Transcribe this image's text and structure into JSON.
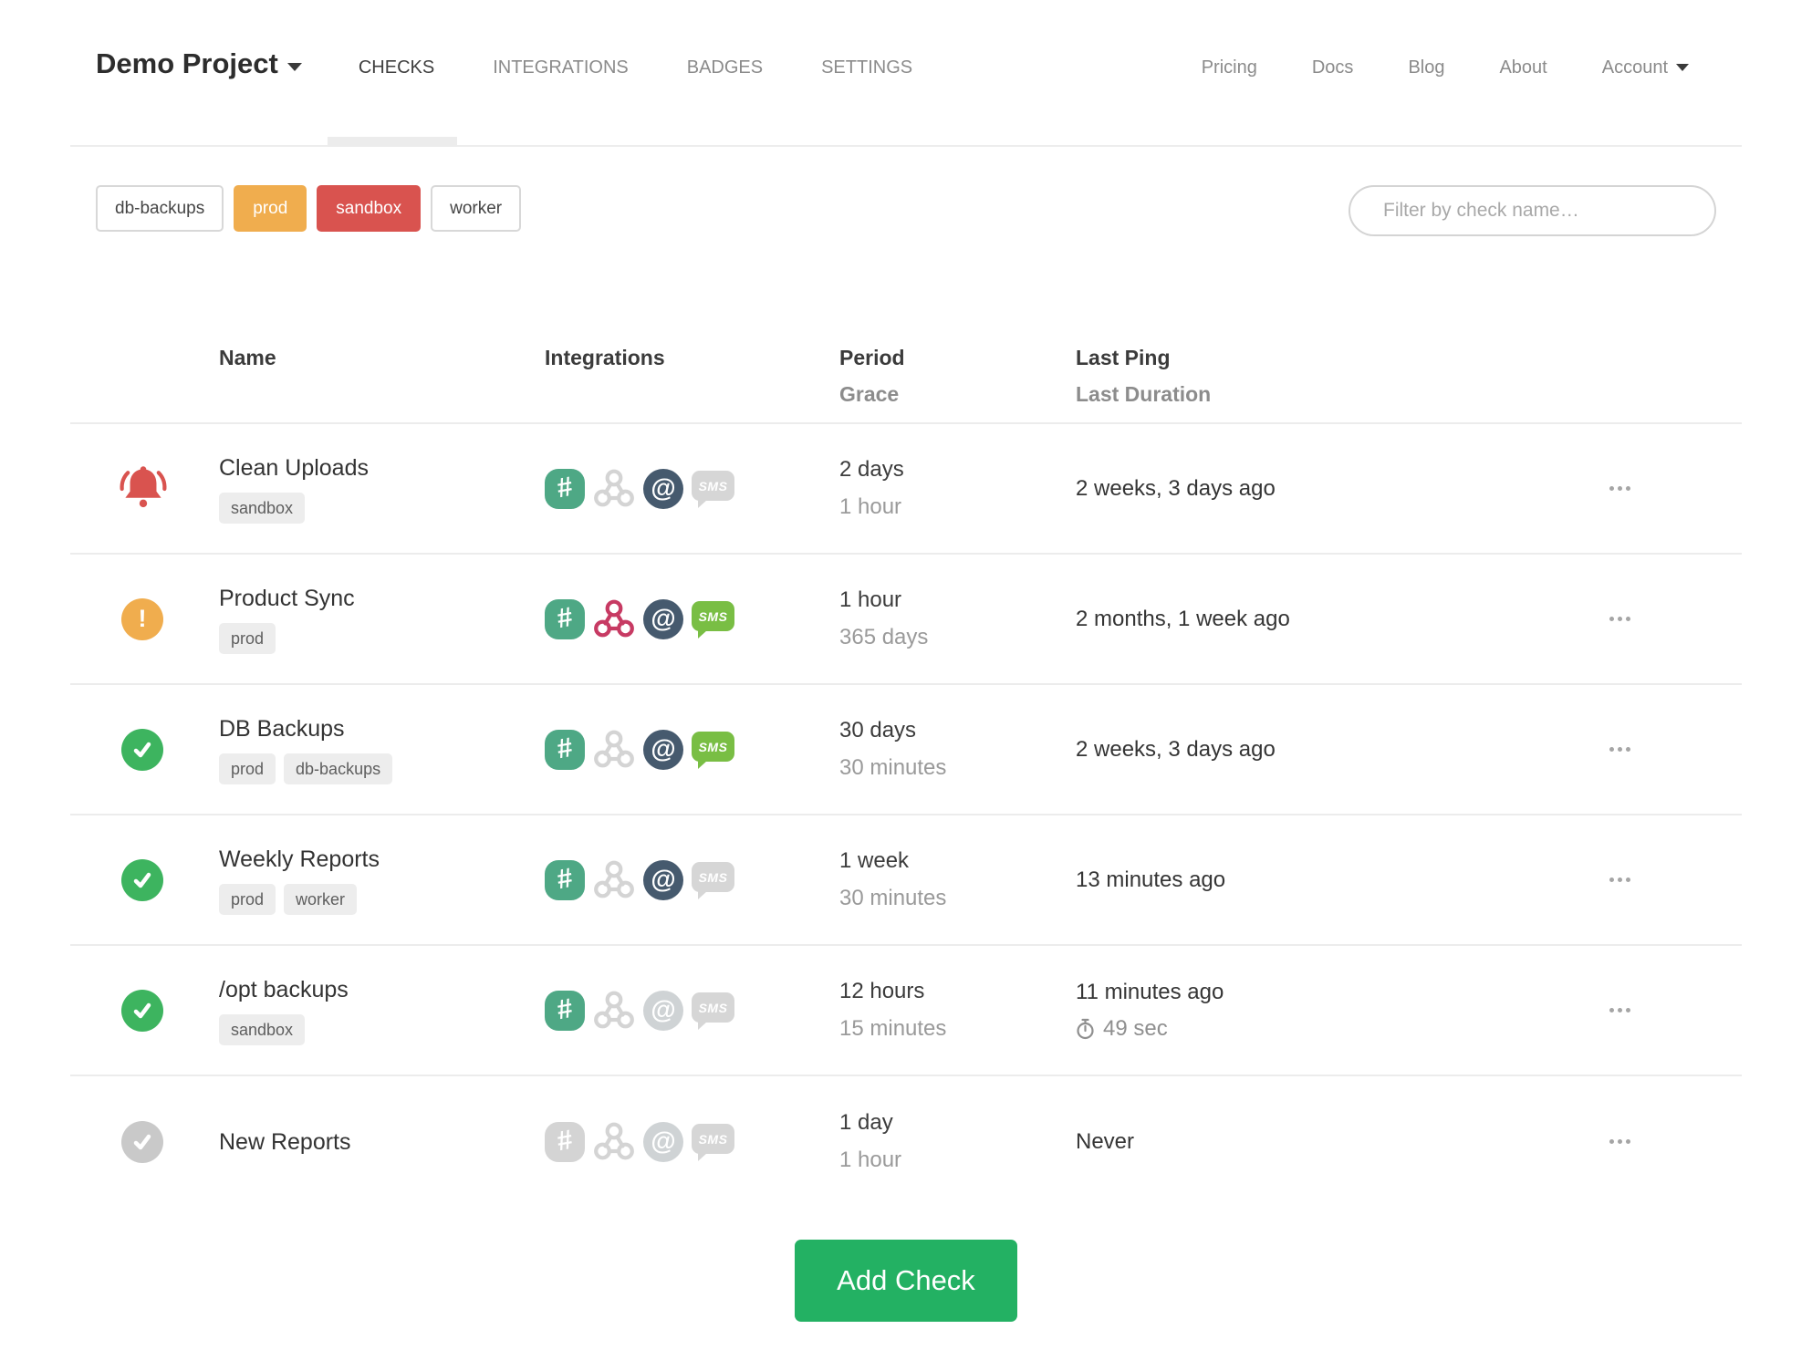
{
  "nav": {
    "project": "Demo Project",
    "tabs": [
      {
        "label": "CHECKS",
        "active": true
      },
      {
        "label": "INTEGRATIONS",
        "active": false
      },
      {
        "label": "BADGES",
        "active": false
      },
      {
        "label": "SETTINGS",
        "active": false
      }
    ],
    "links": [
      "Pricing",
      "Docs",
      "Blog",
      "About"
    ],
    "account_label": "Account"
  },
  "filters": {
    "tags": [
      {
        "label": "db-backups",
        "style": "outline"
      },
      {
        "label": "prod",
        "style": "orange"
      },
      {
        "label": "sandbox",
        "style": "red"
      },
      {
        "label": "worker",
        "style": "outline"
      }
    ],
    "search_placeholder": "Filter by check name…"
  },
  "table": {
    "headers": {
      "name": "Name",
      "integrations": "Integrations",
      "period": "Period",
      "grace": "Grace",
      "last_ping": "Last Ping",
      "last_duration": "Last Duration"
    },
    "rows": [
      {
        "status": "alert",
        "name": "Clean Uploads",
        "tags": [
          "sandbox"
        ],
        "integrations": {
          "slack": true,
          "webhook": false,
          "email": true,
          "sms": false
        },
        "period": "2 days",
        "grace": "1 hour",
        "last_ping": "2 weeks, 3 days ago",
        "last_duration": ""
      },
      {
        "status": "warning",
        "name": "Product Sync",
        "tags": [
          "prod"
        ],
        "integrations": {
          "slack": true,
          "webhook": true,
          "email": true,
          "sms": true
        },
        "period": "1 hour",
        "grace": "365 days",
        "last_ping": "2 months, 1 week ago",
        "last_duration": ""
      },
      {
        "status": "up",
        "name": "DB Backups",
        "tags": [
          "prod",
          "db-backups"
        ],
        "integrations": {
          "slack": true,
          "webhook": false,
          "email": true,
          "sms": true
        },
        "period": "30 days",
        "grace": "30 minutes",
        "last_ping": "2 weeks, 3 days ago",
        "last_duration": ""
      },
      {
        "status": "up",
        "name": "Weekly Reports",
        "tags": [
          "prod",
          "worker"
        ],
        "integrations": {
          "slack": true,
          "webhook": false,
          "email": true,
          "sms": false
        },
        "period": "1 week",
        "grace": "30 minutes",
        "last_ping": "13 minutes ago",
        "last_duration": ""
      },
      {
        "status": "up",
        "name": "/opt backups",
        "tags": [
          "sandbox"
        ],
        "integrations": {
          "slack": true,
          "webhook": false,
          "email": false,
          "sms": false
        },
        "period": "12 hours",
        "grace": "15 minutes",
        "last_ping": "11 minutes ago",
        "last_duration": "49 sec"
      },
      {
        "status": "new",
        "name": "New Reports",
        "tags": [],
        "integrations": {
          "slack": false,
          "webhook": false,
          "email": false,
          "sms": false
        },
        "period": "1 day",
        "grace": "1 hour",
        "last_ping": "Never",
        "last_duration": ""
      }
    ]
  },
  "footer": {
    "add_check_label": "Add Check"
  },
  "icons": {
    "slack_glyph": "#",
    "email_glyph": "@",
    "sms_glyph": "SMS",
    "warning_glyph": "!"
  },
  "colors": {
    "accent_green": "#23b163",
    "status_up": "#3db45f",
    "status_new": "#c9c9c9",
    "status_warning": "#f0ad4e",
    "status_alert": "#d9534f",
    "tag_orange": "#f0ad4e",
    "tag_red": "#d9534f",
    "slack_green": "#4ea885",
    "webhook_crimson": "#c73a63",
    "email_slate": "#465a6e",
    "sms_green": "#79be44"
  }
}
